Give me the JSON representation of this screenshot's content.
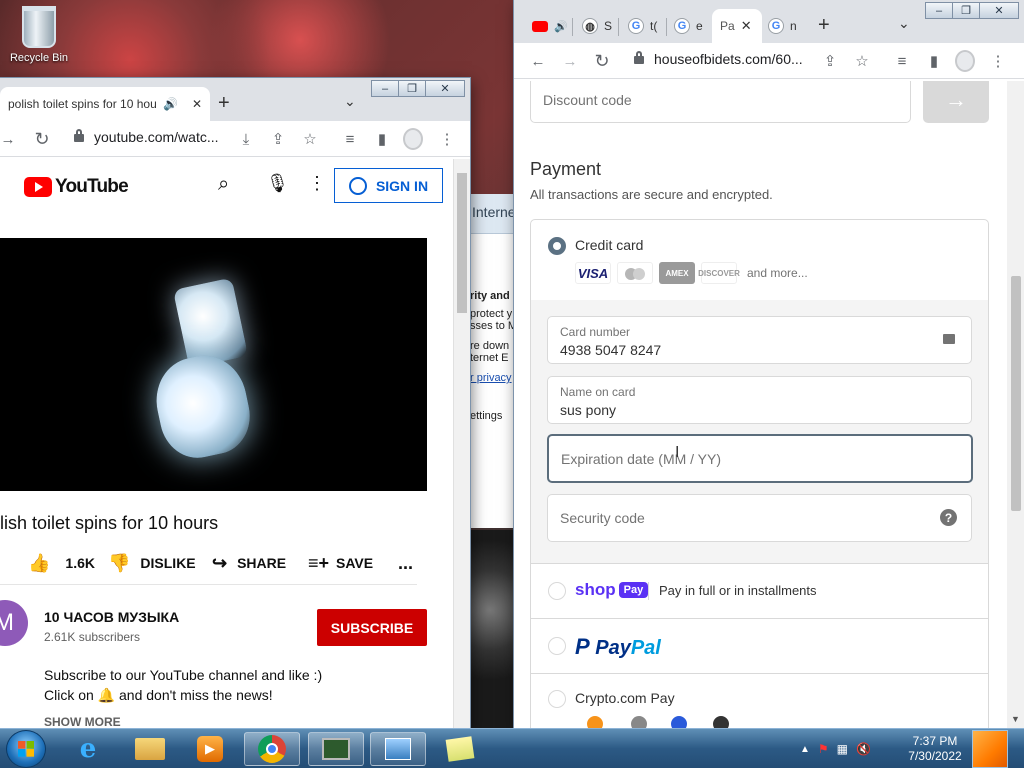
{
  "desktop": {
    "recycle_bin_label": "Recycle Bin",
    "bg_window": {
      "header": "Interne",
      "line1": "rity and",
      "line2": "protect y",
      "line3": "sses to M",
      "line4": "re down",
      "line5": "ternet E",
      "link": "r privacy",
      "settings": "ettings"
    }
  },
  "left_window": {
    "tab_title": "polish toilet spins for 10 hou",
    "url": "youtube.com/watc...",
    "youtube": {
      "logo_text": "YouTube",
      "sign_in": "SIGN IN",
      "video_title": "lish toilet spins for 10 hours",
      "likes": "1.6K",
      "dislike": "DISLIKE",
      "share": "SHARE",
      "save": "SAVE",
      "more": "...",
      "channel_initial": "M",
      "channel_name": "10 ЧАСОВ МУЗЫКА",
      "subscribers": "2.61K subscribers",
      "subscribe": "SUBSCRIBE",
      "desc_line1": "Subscribe to our YouTube channel and like :)",
      "desc_line2": "Click on 🔔 and don't miss the news!",
      "show_more": "SHOW MORE"
    }
  },
  "right_window": {
    "tabs": [
      {
        "label": "S"
      },
      {
        "label": "t("
      },
      {
        "label": "e"
      },
      {
        "label": "Pa"
      },
      {
        "label": "n"
      }
    ],
    "url": "houseofbidets.com/60...",
    "checkout": {
      "discount_placeholder": "Discount code",
      "payment_heading": "Payment",
      "payment_sub": "All transactions are secure and encrypted.",
      "credit_card_label": "Credit card",
      "card_brands": [
        "VISA",
        "",
        "AMEX",
        "DISCOVER"
      ],
      "and_more": "and more...",
      "card_number_label": "Card number",
      "card_number_value": "4938 5047 8247",
      "name_label": "Name on card",
      "name_value": "sus pony",
      "expiration_placeholder": "Expiration date (MM / YY)",
      "security_placeholder": "Security code",
      "shop_pay_text": "shop",
      "shop_pay_badge": "Pay",
      "shop_pay_desc": "Pay in full or in installments",
      "paypal_a": "Pay",
      "paypal_b": "Pal",
      "crypto_label": "Crypto.com Pay"
    }
  },
  "taskbar": {
    "time": "7:37 PM",
    "date": "7/30/2022"
  },
  "colors": {
    "youtube_red": "#ff0000",
    "subscribe_red": "#cc0000",
    "signin_blue": "#065fd4",
    "shop_purple": "#5a31f4",
    "radio_selected": "#5b7183"
  }
}
